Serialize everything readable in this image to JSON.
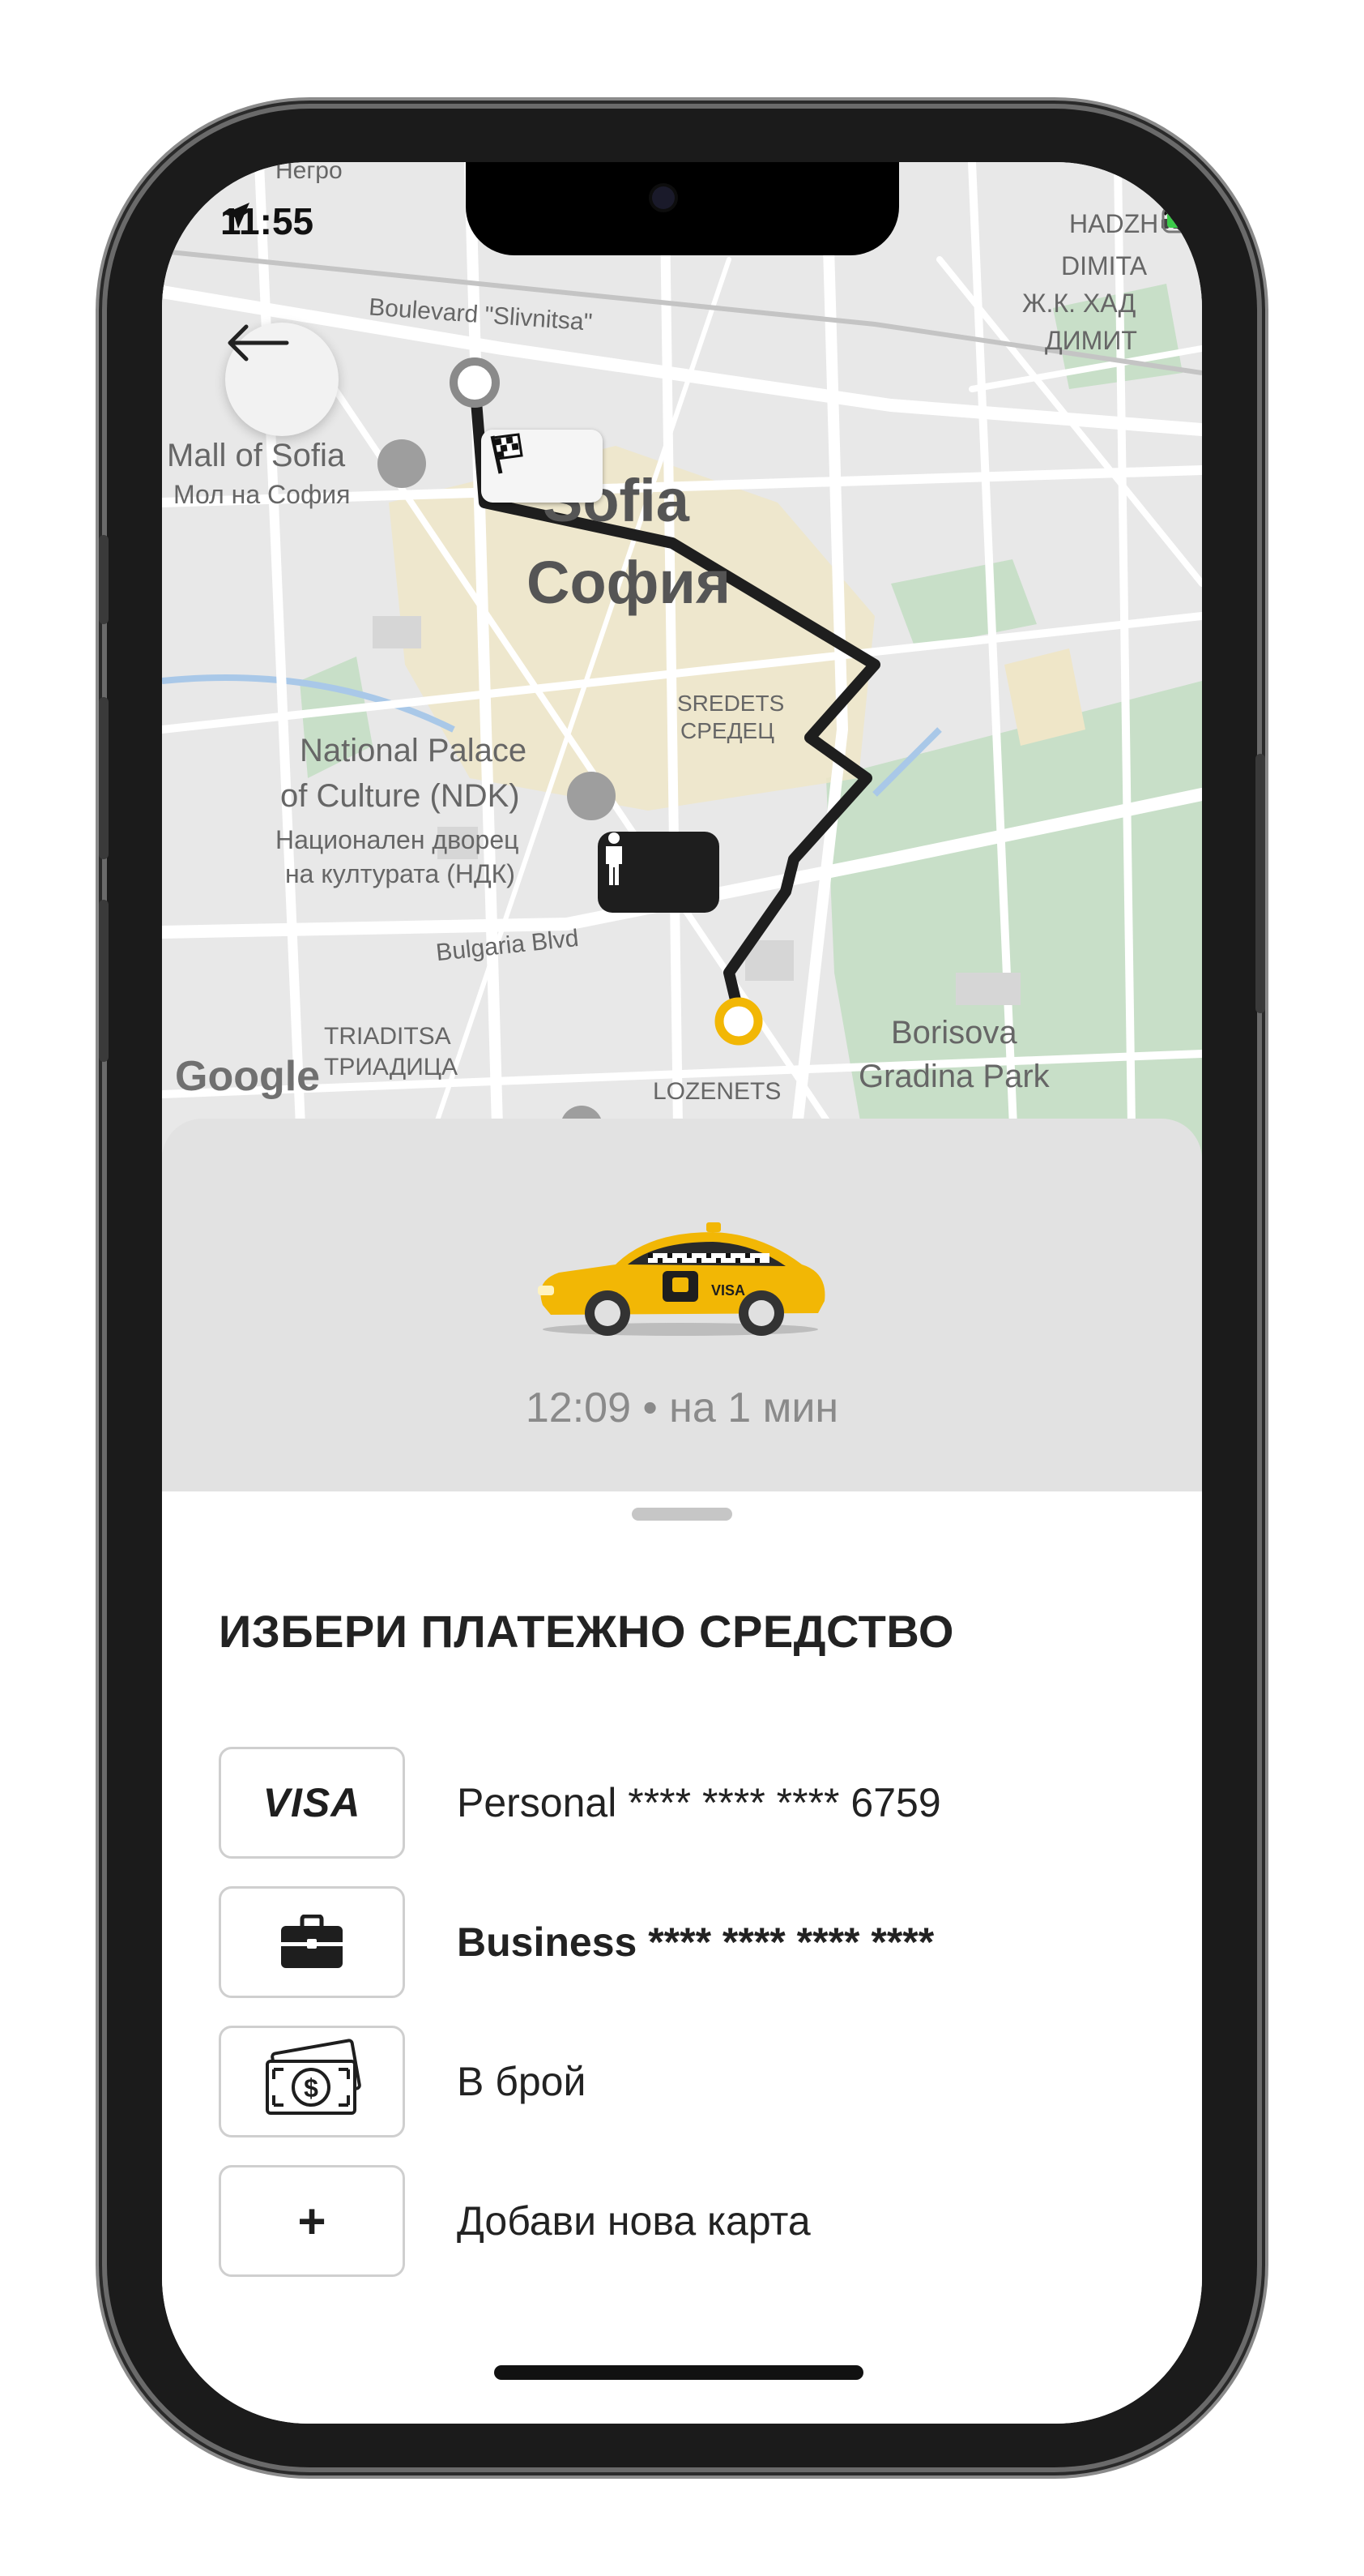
{
  "status_bar": {
    "time": "11:55"
  },
  "map": {
    "labels": {
      "top_left_fragment": "Негро",
      "boulevard": "Boulevard \"Slivnitsa\"",
      "mall_en": "Mall of Sofia",
      "mall_bg": "Мол на София",
      "city_en": "Sofia",
      "city_bg": "София",
      "sredets_en": "SREDETS",
      "sredets_bg": "СРЕДЕЦ",
      "ndk_en_1": "National Palace",
      "ndk_en_2": "of Culture (NDK)",
      "ndk_bg_1": "Национален дворец",
      "ndk_bg_2": "на културата (НДК)",
      "bulgaria_blvd": "Bulgaria Blvd",
      "triaditsa_en": "TRIADITSA",
      "triaditsa_bg": "ТРИАДИЦА",
      "lozenets": "LOZENETS",
      "borisova_1": "Borisova",
      "borisova_2": "Gradina Park",
      "hadzhi_1": "HADZH",
      "hadzhi_2": "DIMITA",
      "hadzhi_3": "Ж.К. ХАД",
      "hadzhi_4": "ДИМИТ",
      "google": "Google"
    }
  },
  "ride_panel": {
    "eta": "12:09 • на 1 мин",
    "car_icon": "yellow-taxi-icon"
  },
  "payment_sheet": {
    "title": "ИЗБЕРИ ПЛАТЕЖНО СРЕДСТВО",
    "options": [
      {
        "icon": "visa-icon",
        "icon_text": "VISA",
        "label": "Personal **** **** **** 6759",
        "bold": false
      },
      {
        "icon": "briefcase-icon",
        "label": "Business **** **** **** ****",
        "bold": true
      },
      {
        "icon": "cash-icon",
        "label": "В брой",
        "bold": false
      },
      {
        "icon": "plus-icon",
        "icon_text": "+",
        "label": "Добави нова карта",
        "bold": false
      }
    ]
  },
  "colors": {
    "route": "#1e1e1e",
    "pickup_marker": "#f2b705",
    "taxi_yellow": "#f2b705",
    "map_bg": "#e8e8e8",
    "park_green": "#c8dfc8",
    "district_yellow": "#efe6c8"
  }
}
